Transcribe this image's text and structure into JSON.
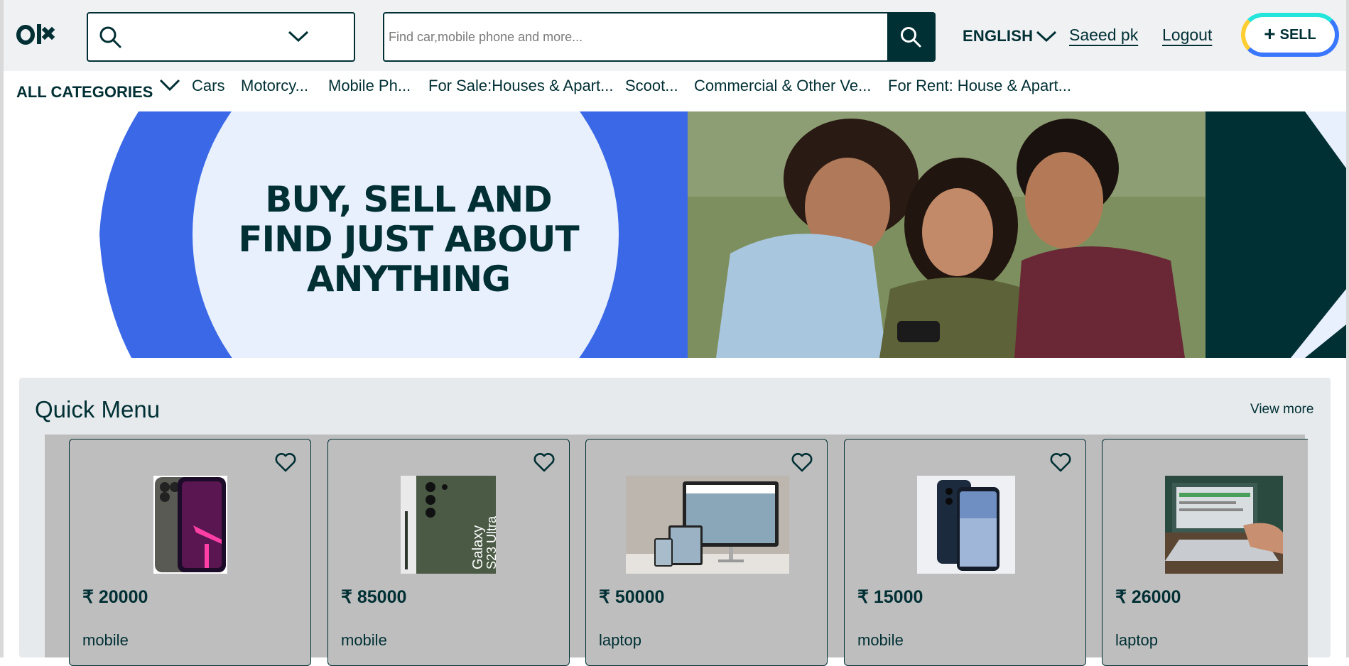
{
  "header": {
    "logo_alt": "OLX",
    "search_placeholder": "Find car,mobile phone and more...",
    "language": "ENGLISH",
    "user_name": "Saeed pk",
    "logout_label": "Logout",
    "sell_label": "SELL"
  },
  "categories": {
    "all_label": "ALL CATEGORIES",
    "items": [
      "Cars",
      "Motorcy...",
      "Mobile Ph...",
      "For Sale:Houses & Apart...",
      "Scoot...",
      "Commercial & Other Ve...",
      "For Rent: House & Apart..."
    ]
  },
  "banner": {
    "headline_line1": "BUY, SELL AND",
    "headline_line2": "FIND JUST ABOUT",
    "headline_line3": "ANYTHING"
  },
  "quick_menu": {
    "title": "Quick Menu",
    "view_more": "View more",
    "cards": [
      {
        "price": "₹ 20000",
        "name": "mobile",
        "image": "iphone-image"
      },
      {
        "price": "₹ 85000",
        "name": "mobile",
        "image": "galaxy-s23-ultra-image"
      },
      {
        "price": "₹ 50000",
        "name": "laptop",
        "image": "devices-image"
      },
      {
        "price": "₹ 15000",
        "name": "mobile",
        "image": "vivo-phone-image"
      },
      {
        "price": "₹ 26000",
        "name": "laptop",
        "image": "laptop-image"
      }
    ]
  },
  "colors": {
    "brand_dark": "#002f34",
    "banner_blue": "#3a68e6",
    "sell_yellow": "#ffce32",
    "sell_cyan": "#23e5db",
    "sell_blue": "#3a77ff"
  }
}
